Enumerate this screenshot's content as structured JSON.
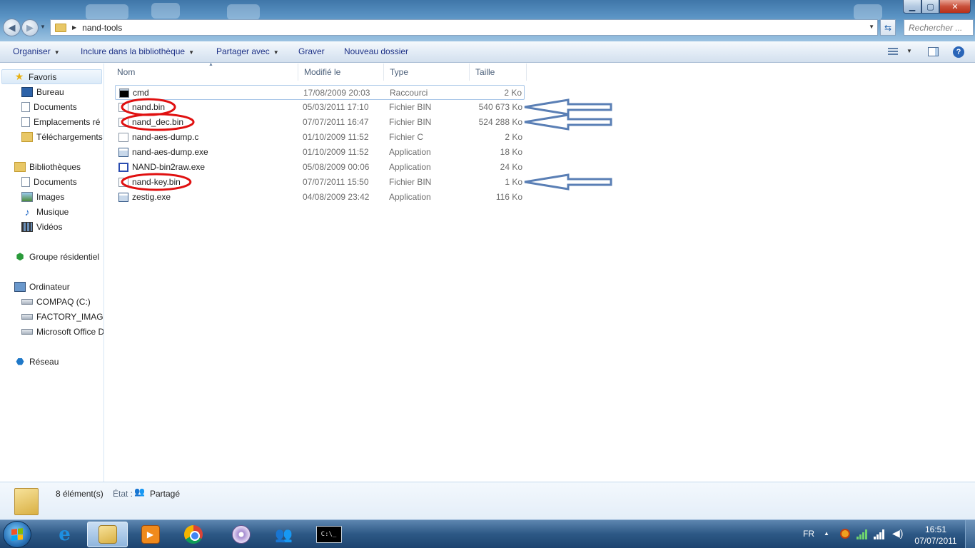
{
  "window": {
    "buttons": {
      "minimize": "▁",
      "maximize": "▢",
      "close": "✕"
    }
  },
  "address_bar": {
    "crumbs": [
      "nand-tools"
    ],
    "search_placeholder": "Rechercher ..."
  },
  "toolbar": {
    "organize": "Organiser",
    "include_library": "Inclure dans la bibliothèque",
    "share_with": "Partager avec",
    "burn": "Graver",
    "new_folder": "Nouveau dossier"
  },
  "sidebar": {
    "favorites": {
      "label": "Favoris",
      "items": [
        "Bureau",
        "Documents",
        "Emplacements ré",
        "Téléchargements"
      ]
    },
    "libraries": {
      "label": "Bibliothèques",
      "items": [
        "Documents",
        "Images",
        "Musique",
        "Vidéos"
      ]
    },
    "homegroup": "Groupe résidentiel",
    "computer": {
      "label": "Ordinateur",
      "items": [
        "COMPAQ (C:)",
        "FACTORY_IMAGE",
        "Microsoft Office D"
      ]
    },
    "network": "Réseau"
  },
  "columns": {
    "name": "Nom",
    "modified": "Modifié le",
    "type": "Type",
    "size": "Taille"
  },
  "files": [
    {
      "name": "cmd",
      "modified": "17/08/2009 20:03",
      "type": "Raccourci",
      "size": "2 Ko",
      "icon": "cmd-shortcut-icon",
      "selected": true
    },
    {
      "name": "nand.bin",
      "modified": "05/03/2011 17:10",
      "type": "Fichier BIN",
      "size": "540 673 Ko",
      "icon": "bin-file-icon",
      "circled": true,
      "arrow": true
    },
    {
      "name": "nand_dec.bin",
      "modified": "07/07/2011 16:47",
      "type": "Fichier BIN",
      "size": "524 288 Ko",
      "icon": "bin-file-icon",
      "circled": true,
      "arrow": true
    },
    {
      "name": "nand-aes-dump.c",
      "modified": "01/10/2009 11:52",
      "type": "Fichier C",
      "size": "2 Ko",
      "icon": "c-file-icon"
    },
    {
      "name": "nand-aes-dump.exe",
      "modified": "01/10/2009 11:52",
      "type": "Application",
      "size": "18 Ko",
      "icon": "exe-file-icon"
    },
    {
      "name": "NAND-bin2raw.exe",
      "modified": "05/08/2009 00:06",
      "type": "Application",
      "size": "24 Ko",
      "icon": "nand-exe-icon"
    },
    {
      "name": "nand-key.bin",
      "modified": "07/07/2011 15:50",
      "type": "Fichier BIN",
      "size": "1 Ko",
      "icon": "bin-file-icon",
      "circled": true,
      "arrow": true
    },
    {
      "name": "zestig.exe",
      "modified": "04/08/2009 23:42",
      "type": "Application",
      "size": "116 Ko",
      "icon": "exe-file-icon"
    }
  ],
  "annotations": {
    "circle_color": "#e01010",
    "arrow_color": "#5a7fb5"
  },
  "details": {
    "count": "8 élément(s)",
    "state_label": "État :",
    "state_value": "Partagé"
  },
  "taskbar": {
    "apps": [
      "internet-explorer",
      "windows-explorer",
      "media-player",
      "chrome",
      "disc-app",
      "messenger",
      "command-prompt"
    ],
    "cmd_label": "C:\\_",
    "lang": "FR",
    "time": "16:51",
    "date": "07/07/2011"
  }
}
